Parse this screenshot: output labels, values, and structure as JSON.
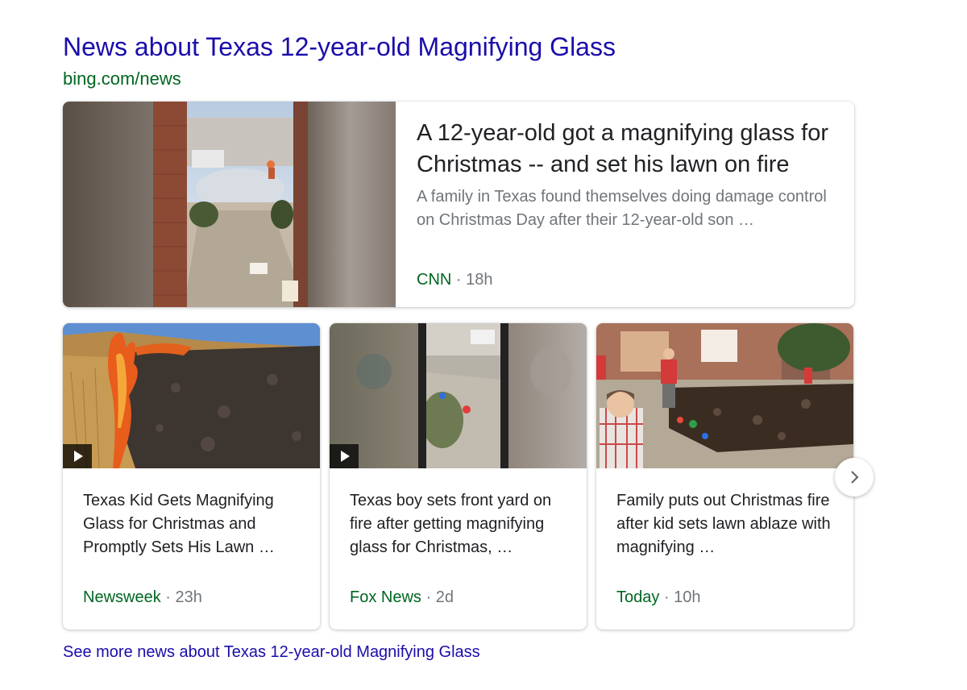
{
  "section": {
    "title": "News about Texas 12-year-old Magnifying Glass",
    "url": "bing.com/news"
  },
  "top_story": {
    "title": "A 12-year-old got a magnifying glass for Christmas -- and set his lawn on fire",
    "snippet": "A family in Texas found themselves doing damage control on Christmas Day after their 12-year-old son …",
    "source": "CNN",
    "separator": "·",
    "age": "18h"
  },
  "stories": [
    {
      "title": "Texas Kid Gets Magnifying Glass for Christmas and Promptly Sets His Lawn …",
      "source": "Newsweek",
      "separator": "·",
      "age": "23h",
      "has_video": true
    },
    {
      "title": "Texas boy sets front yard on fire after getting magnifying glass for Christmas, …",
      "source": "Fox News",
      "separator": "·",
      "age": "2d",
      "has_video": true
    },
    {
      "title": "Family puts out Christmas fire after kid sets lawn ablaze with magnifying …",
      "source": "Today",
      "separator": "·",
      "age": "10h",
      "has_video": false
    }
  ],
  "next_button": {
    "icon": "chevron-right-icon"
  },
  "more_link": "See more news about Texas 12-year-old Magnifying Glass",
  "colors": {
    "link": "#1a0dab",
    "url_green": "#006621",
    "muted": "#70757a",
    "text": "#202124"
  }
}
